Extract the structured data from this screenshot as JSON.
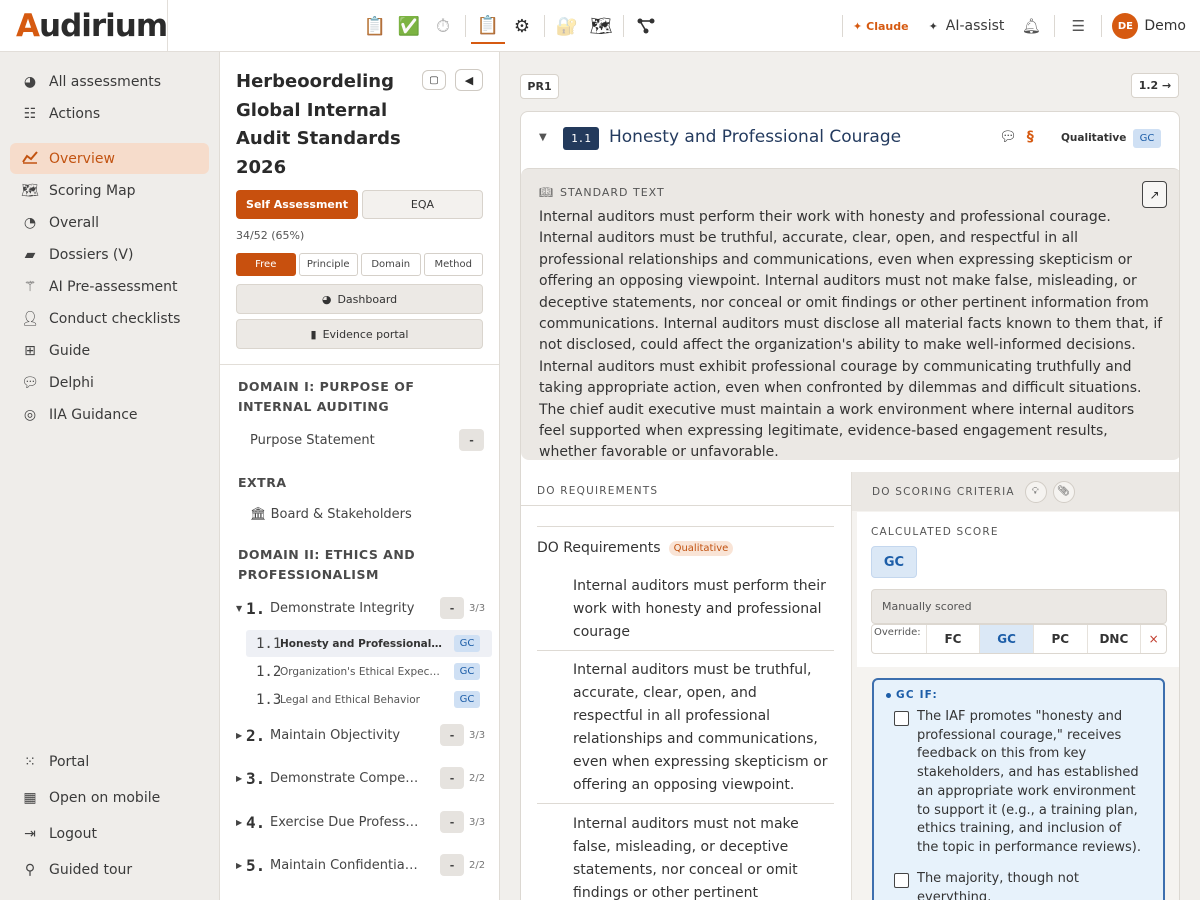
{
  "app": {
    "logo_pre": "A",
    "logo_rest": "udirium"
  },
  "toolbar": {
    "icons": [
      "clipboard-icon",
      "checkmark-icon",
      "timer-icon",
      "clipboard-list-icon",
      "gear-icon",
      "folder-lock-icon",
      "map-icon",
      "graph-icon"
    ]
  },
  "topbar": {
    "claude": "Claude",
    "ai_assist": "AI-assist",
    "avatar": "DE",
    "user": "Demo"
  },
  "sidebar": {
    "items": [
      {
        "label": "All assessments",
        "icon": "palette-icon"
      },
      {
        "label": "Actions",
        "icon": "list-check-icon"
      },
      {
        "label": "Overview",
        "icon": "chart-line-icon",
        "active": true
      },
      {
        "label": "Scoring Map",
        "icon": "map-icon"
      },
      {
        "label": "Overall",
        "icon": "pie-chart-icon"
      },
      {
        "label": "Dossiers (V)",
        "icon": "folder-icon"
      },
      {
        "label": "AI Pre-assessment",
        "icon": "magic-wand-icon"
      },
      {
        "label": "Conduct checklists",
        "icon": "user-check-icon"
      },
      {
        "label": "Guide",
        "icon": "sitemap-icon"
      },
      {
        "label": "Delphi",
        "icon": "chat-icon"
      },
      {
        "label": "IIA Guidance",
        "icon": "compass-icon"
      }
    ],
    "bottom": [
      {
        "label": "Portal",
        "icon": "grid-icon"
      },
      {
        "label": "Open on mobile",
        "icon": "qr-icon"
      },
      {
        "label": "Logout",
        "icon": "logout-icon"
      },
      {
        "label": "Guided tour",
        "icon": "map-pin-icon"
      }
    ]
  },
  "assessment": {
    "title": "Herbeoordeling Global Internal Audit Standards 2026",
    "self_assessment": "Self Assessment",
    "eqa": "EQA",
    "progress": "34/52 (65%)",
    "filters": [
      "Free",
      "Principle",
      "Domain",
      "Method"
    ],
    "dashboard": "Dashboard",
    "evidence": "Evidence portal"
  },
  "tree": {
    "domain1": "DOMAIN I: PURPOSE OF INTERNAL AUDITING",
    "purpose": "Purpose Statement",
    "extra": "EXTRA",
    "board": "🏛 Board & Stakeholders",
    "domain2": "DOMAIN II: ETHICS AND PROFESSIONALISM",
    "dash": "-",
    "principles": [
      {
        "num": "1.",
        "label": "Demonstrate Integrity",
        "count": "3/3",
        "open": true
      },
      {
        "num": "2.",
        "label": "Maintain Objectivity",
        "count": "3/3"
      },
      {
        "num": "3.",
        "label": "Demonstrate Competency",
        "count": "2/2"
      },
      {
        "num": "4.",
        "label": "Exercise Due Professional Care",
        "count": "3/3"
      },
      {
        "num": "5.",
        "label": "Maintain Confidentiality",
        "count": "2/2"
      }
    ],
    "standards": [
      {
        "num": "1.1",
        "label": "Honesty and Professional Courage",
        "score": "GC",
        "active": true
      },
      {
        "num": "1.2",
        "label": "Organization's Ethical Expectations",
        "score": "GC"
      },
      {
        "num": "1.3",
        "label": "Legal and Ethical Behavior",
        "score": "GC"
      }
    ]
  },
  "main": {
    "pr_tag": "PR1",
    "next": "1.2 →",
    "std_num": "1.1",
    "std_title": "Honesty and Professional Courage",
    "method": "Qualitative",
    "score_badge": "GC",
    "std_text_label": "STANDARD TEXT",
    "std_text": "Internal auditors must perform their work with honesty and professional courage. Internal auditors must be truthful, accurate, clear, open, and respectful in all professional relationships and communications, even when expressing skepticism or offering an opposing viewpoint. Internal auditors must not make false, misleading, or deceptive statements, nor conceal or omit findings or other pertinent information from communications. Internal auditors must disclose all material facts known to them that, if not disclosed, could affect the organization's ability to make well-informed decisions. Internal auditors must exhibit professional courage by communicating truthfully and taking appropriate action, even when confronted by dilemmas and difficult situations. The chief audit executive must maintain a work environment where internal auditors feel supported when expressing legitimate, evidence-based engagement results, whether favorable or unfavorable.",
    "do_req_head": "DO REQUIREMENTS",
    "do_req_sub": "DO Requirements",
    "do_req_chip": "Qualitative",
    "requirements": [
      "Internal auditors must perform their work with honesty and professional courage",
      "Internal auditors must be truthful, accurate, clear, open, and respectful in all professional relationships and communications, even when expressing skepticism or offering an opposing viewpoint.",
      "Internal auditors must not make false, misleading, or deceptive statements, nor conceal or omit findings or other pertinent information from"
    ],
    "scoring_head": "DO SCORING CRITERIA",
    "calc_label": "CALCULATED SCORE",
    "calc_value": "GC",
    "manual": "Manually scored",
    "override_label": "Override:",
    "override_opts": [
      "FC",
      "GC",
      "PC",
      "DNC"
    ],
    "override_selected": "GC",
    "override_clear": "×",
    "gc_if_label": "GC IF:",
    "criteria": [
      "The IAF promotes \"honesty and professional courage,\" receives feedback on this from key stakeholders, and has established an appropriate work environment to support it (e.g., a training plan, ethics training, and inclusion of the topic in performance reviews).",
      "The majority, though not everything,"
    ]
  },
  "colors": {
    "accent": "#d65a11",
    "navy": "#233a5c",
    "gc_blue": "#1d5ea8"
  }
}
